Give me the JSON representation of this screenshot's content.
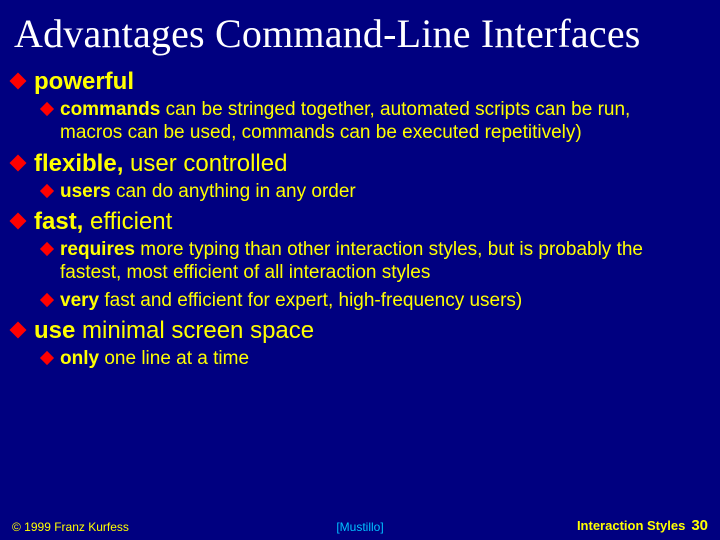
{
  "title": "Advantages Command-Line Interfaces",
  "items": [
    {
      "lead": "powerful",
      "rest": "",
      "subs": [
        {
          "lead": "commands",
          "rest": " can be stringed together, automated scripts can be run, macros can be used, commands can be executed repetitively)"
        }
      ]
    },
    {
      "lead": "flexible,",
      "rest": " user controlled",
      "subs": [
        {
          "lead": "users",
          "rest": " can do anything in any order"
        }
      ]
    },
    {
      "lead": "fast,",
      "rest": " efficient",
      "subs": [
        {
          "lead": "requires",
          "rest": " more typing than other interaction styles, but is probably the fastest, most efficient of all interaction styles"
        },
        {
          "lead": "very",
          "rest": " fast and efficient for expert, high-frequency users)"
        }
      ]
    },
    {
      "lead": "use",
      "rest": " minimal screen space",
      "subs": [
        {
          "lead": "only",
          "rest": " one line at a time"
        }
      ]
    }
  ],
  "footer": {
    "copyright": "© 1999 Franz Kurfess",
    "reference": "[Mustillo]",
    "section": "Interaction Styles",
    "page": "30"
  }
}
